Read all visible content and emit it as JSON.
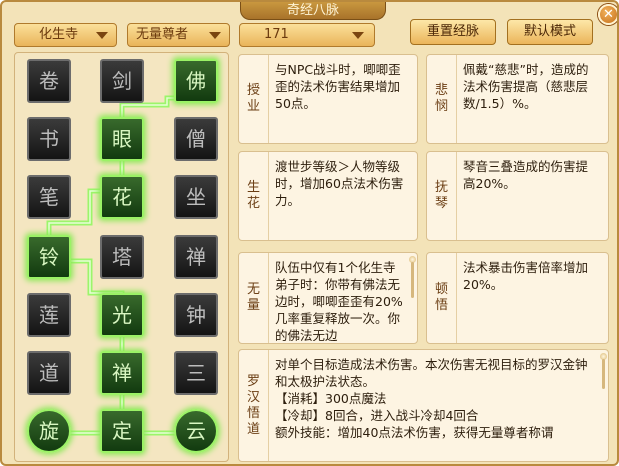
{
  "window": {
    "title": "奇经八脉",
    "close_glyph": "✕"
  },
  "toolbar": {
    "sect": "化生寺",
    "school": "无量尊者",
    "level": "171",
    "reset_label": "重置经脉",
    "default_label": "默认模式"
  },
  "tree": {
    "nodes": [
      {
        "id": "r1c1",
        "glyph": "卷",
        "active": false
      },
      {
        "id": "r1c2",
        "glyph": "剑",
        "active": false
      },
      {
        "id": "r1c3",
        "glyph": "佛",
        "active": true
      },
      {
        "id": "r2c1",
        "glyph": "书",
        "active": false
      },
      {
        "id": "r2c2",
        "glyph": "眼",
        "active": true
      },
      {
        "id": "r2c3",
        "glyph": "僧",
        "active": false
      },
      {
        "id": "r3c1",
        "glyph": "笔",
        "active": false
      },
      {
        "id": "r3c2",
        "glyph": "花",
        "active": true
      },
      {
        "id": "r3c3",
        "glyph": "坐",
        "active": false
      },
      {
        "id": "r4c1",
        "glyph": "铃",
        "active": true
      },
      {
        "id": "r4c2",
        "glyph": "塔",
        "active": false
      },
      {
        "id": "r4c3",
        "glyph": "禅",
        "active": false
      },
      {
        "id": "r5c1",
        "glyph": "莲",
        "active": false
      },
      {
        "id": "r5c2",
        "glyph": "光",
        "active": true
      },
      {
        "id": "r5c3",
        "glyph": "钟",
        "active": false
      },
      {
        "id": "r6c1",
        "glyph": "道",
        "active": false
      },
      {
        "id": "r6c2",
        "glyph": "禅",
        "active": true
      },
      {
        "id": "r6c3",
        "glyph": "三",
        "active": false
      },
      {
        "id": "r7c1",
        "glyph": "旋",
        "active": true
      },
      {
        "id": "r7c2",
        "glyph": "定",
        "active": true
      },
      {
        "id": "r7c3",
        "glyph": "云",
        "active": true
      }
    ]
  },
  "cards": {
    "shouye": {
      "label": "授业",
      "text": "与NPC战斗时，唧唧歪歪的法术伤害结果增加50点。"
    },
    "beimin": {
      "label": "悲悯",
      "text": "佩戴“慈悲”时，造成的法术伤害提高（慈悲层数/1.5）%。"
    },
    "shenghua": {
      "label": "生花",
      "text": "渡世步等级＞人物等级时，增加60点法术伤害力。"
    },
    "fuqin": {
      "label": "抚琴",
      "text": "琴音三叠造成的伤害提高20%。"
    },
    "wuliang": {
      "label": "无量",
      "text": "队伍中仅有1个化生寺弟子时：你带有佛法无边时，唧唧歪歪有20%几率重复释放一次。你的佛法无边"
    },
    "dunwu": {
      "label": "顿悟",
      "text": "法术暴击伤害倍率增加20%。"
    },
    "luohan": {
      "label": "罗汉悟道",
      "lines": [
        "对单个目标造成法术伤害。本次伤害无视目标的罗汉金钟和太极护法状态。",
        "【消耗】300点魔法",
        "【冷却】8回合，进入战斗冷却4回合",
        "额外技能：增加40点法术伤害，获得无量尊者称谓"
      ]
    }
  }
}
